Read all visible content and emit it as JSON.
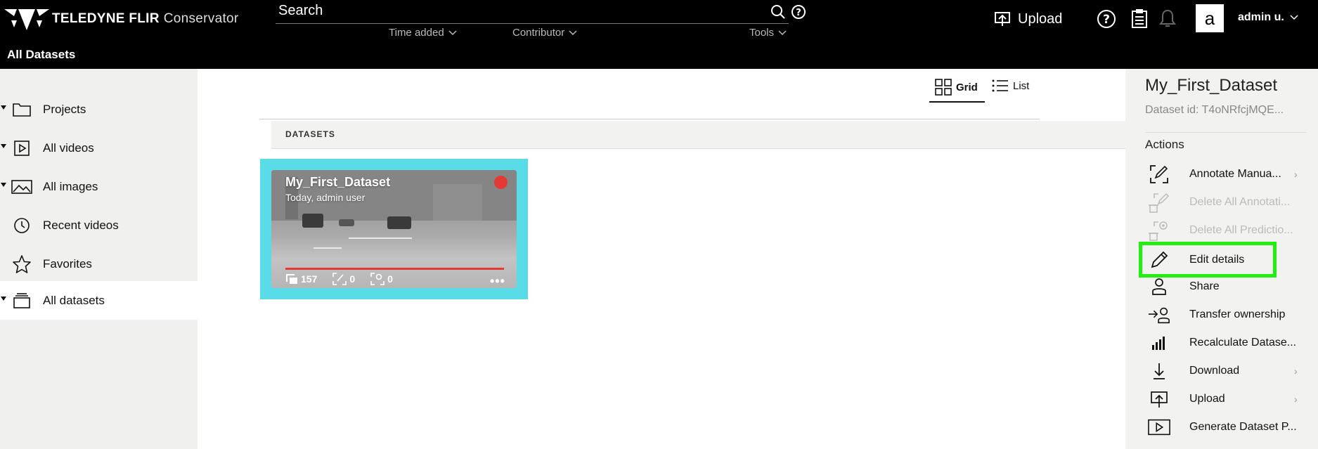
{
  "header": {
    "brand": "TELEDYNE FLIR",
    "product": "Conservator",
    "page_title": "All Datasets",
    "search_placeholder": "Search",
    "filters": [
      {
        "label": "Time added"
      },
      {
        "label": "Contributor"
      },
      {
        "label": "Tools"
      }
    ],
    "upload_label": "Upload",
    "avatar_letter": "a",
    "user_name": "admin u."
  },
  "sidebar": {
    "items": [
      {
        "label": "Projects",
        "icon": "folder-icon"
      },
      {
        "label": "All videos",
        "icon": "video-icon"
      },
      {
        "label": "All images",
        "icon": "image-icon"
      },
      {
        "label": "Recent videos",
        "icon": "clock-icon"
      },
      {
        "label": "Favorites",
        "icon": "star-icon"
      },
      {
        "label": "All datasets",
        "icon": "dataset-icon",
        "active": true
      }
    ]
  },
  "main": {
    "view_grid_label": "Grid",
    "view_list_label": "List",
    "section_label": "DATASETS",
    "cards": [
      {
        "title": "My_First_Dataset",
        "subtitle": "Today, admin user",
        "frames": "157",
        "annotations": "0",
        "predictions": "0",
        "progress": 1.0,
        "status_color": "#e53935"
      }
    ]
  },
  "panel": {
    "title": "My_First_Dataset",
    "dataset_id": "Dataset id: T4oNRfcjMQE...",
    "actions_heading": "Actions",
    "actions": [
      {
        "label": "Annotate Manua...",
        "icon": "annotate-icon",
        "chevron": true,
        "disabled": false
      },
      {
        "label": "Delete All Annotati...",
        "icon": "delete-annotations-icon",
        "chevron": false,
        "disabled": true
      },
      {
        "label": "Delete All Predictio...",
        "icon": "delete-predictions-icon",
        "chevron": false,
        "disabled": true
      },
      {
        "label": "Edit details",
        "icon": "pencil-icon",
        "chevron": false,
        "disabled": false,
        "highlight": true
      },
      {
        "label": "Share",
        "icon": "share-user-icon",
        "chevron": false,
        "disabled": false
      },
      {
        "label": "Transfer ownership",
        "icon": "transfer-icon",
        "chevron": false,
        "disabled": false
      },
      {
        "label": "Recalculate Datase...",
        "icon": "bar-chart-icon",
        "chevron": false,
        "disabled": false
      },
      {
        "label": "Download",
        "icon": "download-icon",
        "chevron": true,
        "disabled": false
      },
      {
        "label": "Upload",
        "icon": "upload-icon",
        "chevron": true,
        "disabled": false
      },
      {
        "label": "Generate Dataset P...",
        "icon": "play-icon",
        "chevron": false,
        "disabled": false
      }
    ]
  },
  "colors": {
    "header_bg": "#000000",
    "card_border": "#5adce8",
    "highlight_outline": "#22ee11",
    "status_red": "#e53935"
  }
}
